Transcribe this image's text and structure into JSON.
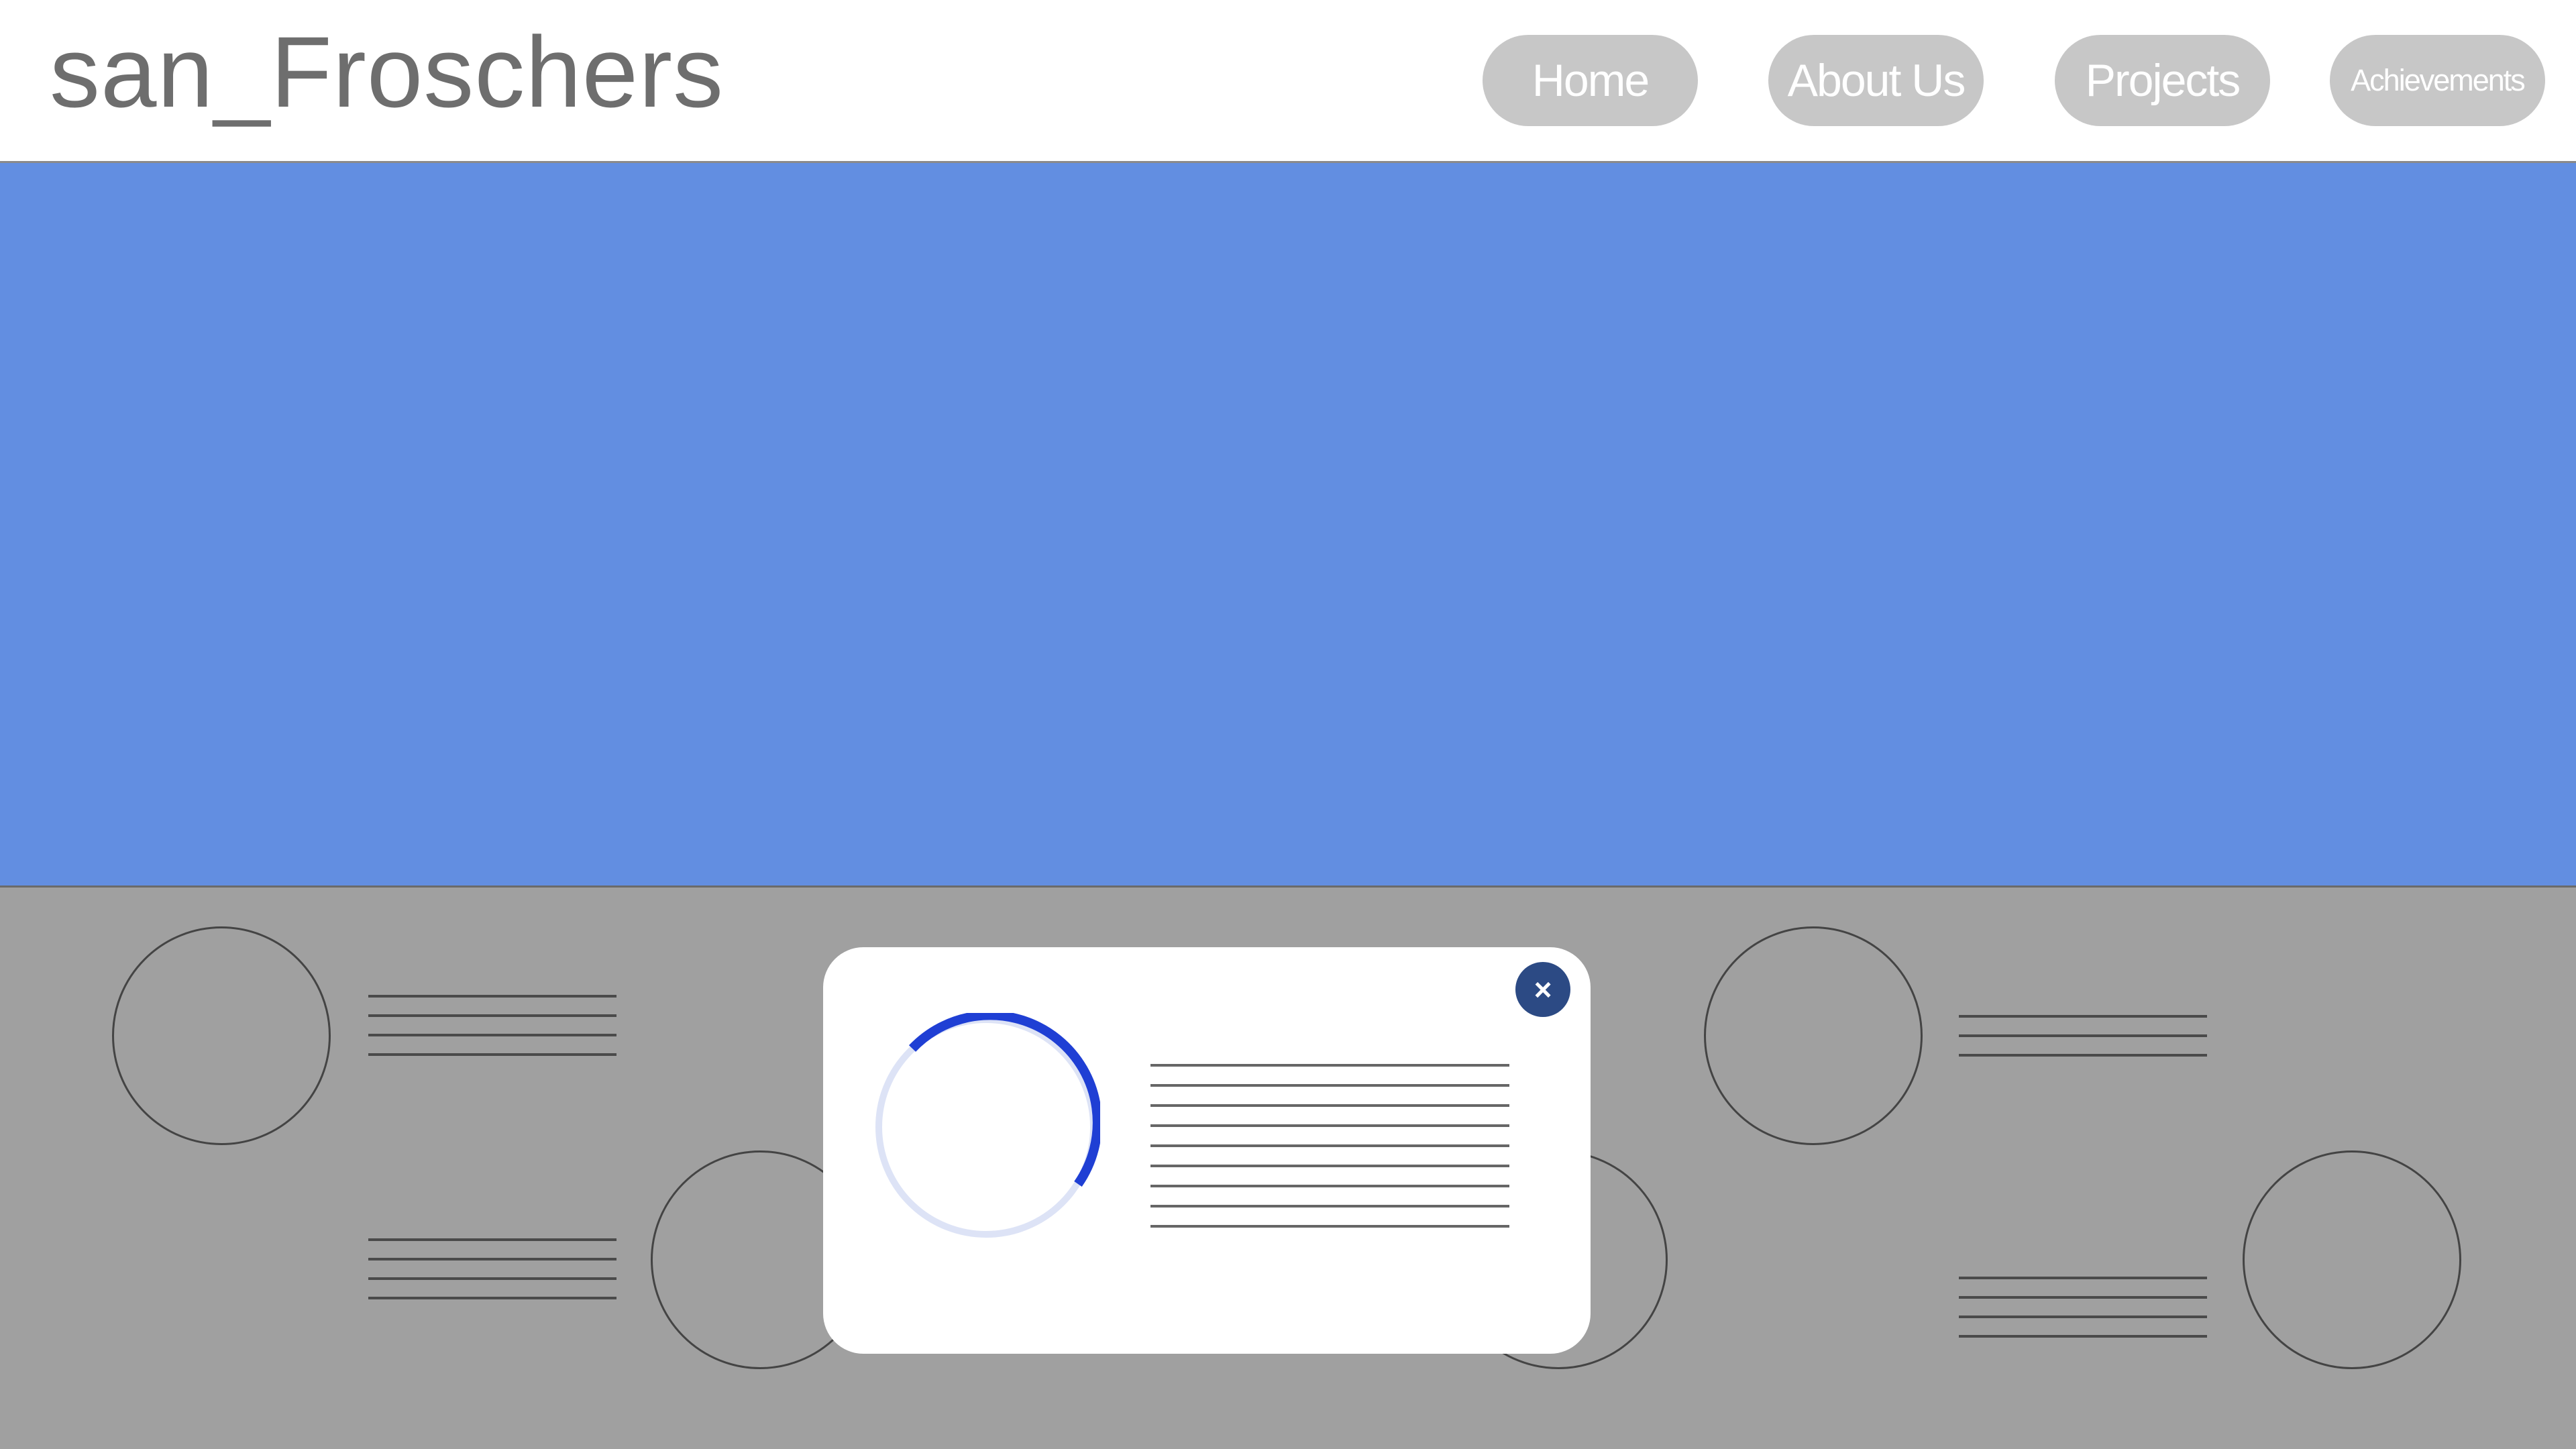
{
  "header": {
    "brand": "san_Froschers",
    "nav": [
      {
        "label": "Home"
      },
      {
        "label": "About Us"
      },
      {
        "label": "Projects"
      },
      {
        "label": "Achievements"
      }
    ]
  },
  "colors": {
    "hero_background": "#628ee1",
    "section_background": "#a0a0a0",
    "nav_button": "#c7c7c7",
    "spinner_track": "#dde3f6",
    "spinner_arc": "#1f3fd4",
    "close_button": "#2c4a84"
  },
  "modal": {
    "close_icon": "×",
    "loading_indicator": "spinner-icon"
  }
}
